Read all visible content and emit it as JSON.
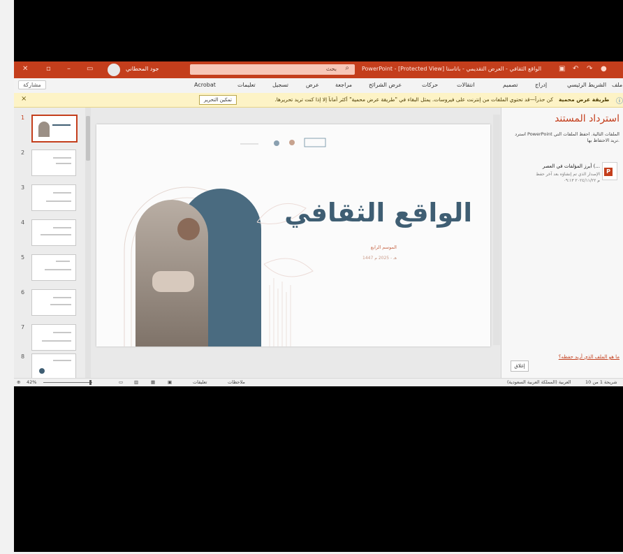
{
  "titlebar": {
    "doc_title": "الواقع الثقافي - العرض التقديمي - باتاستا",
    "app_title": "PowerPoint - [Protected View]",
    "search_placeholder": "بحث",
    "username": "جود المحطاني",
    "bg_color": "#c43e1c"
  },
  "ribbon": {
    "share_label": "مشاركة",
    "tabs": [
      "ملف",
      "الشريط الرئيسي",
      "إدراج",
      "تصميم",
      "انتقالات",
      "حركات",
      "عرض الشرائح",
      "مراجعة",
      "عرض",
      "تسجيل",
      "تعليمات",
      "Acrobat"
    ]
  },
  "protected_bar": {
    "title": "طريقة عرض محمية",
    "message": "كن حذراً—قد تحتوي الملفات من إنترنت على فيروسات. يمثل البقاء في \"طريقة عرض محمية\" أكثر أماناً إلا إذا كنت تريد تحريرها.",
    "enable_button": "تمكين التحرير"
  },
  "thumbnails": [
    "1",
    "2",
    "3",
    "4",
    "5",
    "6",
    "7",
    "8"
  ],
  "slide": {
    "title": "الواقع الثقافي",
    "subtitle": "الموسم الرابع",
    "date": "1447 هـ - 2025 م",
    "accent": "#3f5e73"
  },
  "recovery_pane": {
    "title": "استرداد المستند",
    "description": "استرد PowerPoint الملفات التالية. احفظ الملفات التي تريد الاحتفاظ بها.",
    "file_name": "أبرز المؤلفات في العصر (...",
    "file_meta1": "الإصدار الذي تم إنشاؤه بعد آخر حفظ",
    "file_meta2": "م ٢٠٢٤/١١/٢٢ ٠٩:١٣",
    "link": "ما هو الملف الذي أريد حفظه؟",
    "close_button": "إغلاق"
  },
  "statusbar": {
    "slide_info": "شريحة 1 من 10",
    "language": "العربية (المملكة العربية السعودية)",
    "notes": "ملاحظات",
    "comments": "تعليقات",
    "zoom": "42%"
  }
}
